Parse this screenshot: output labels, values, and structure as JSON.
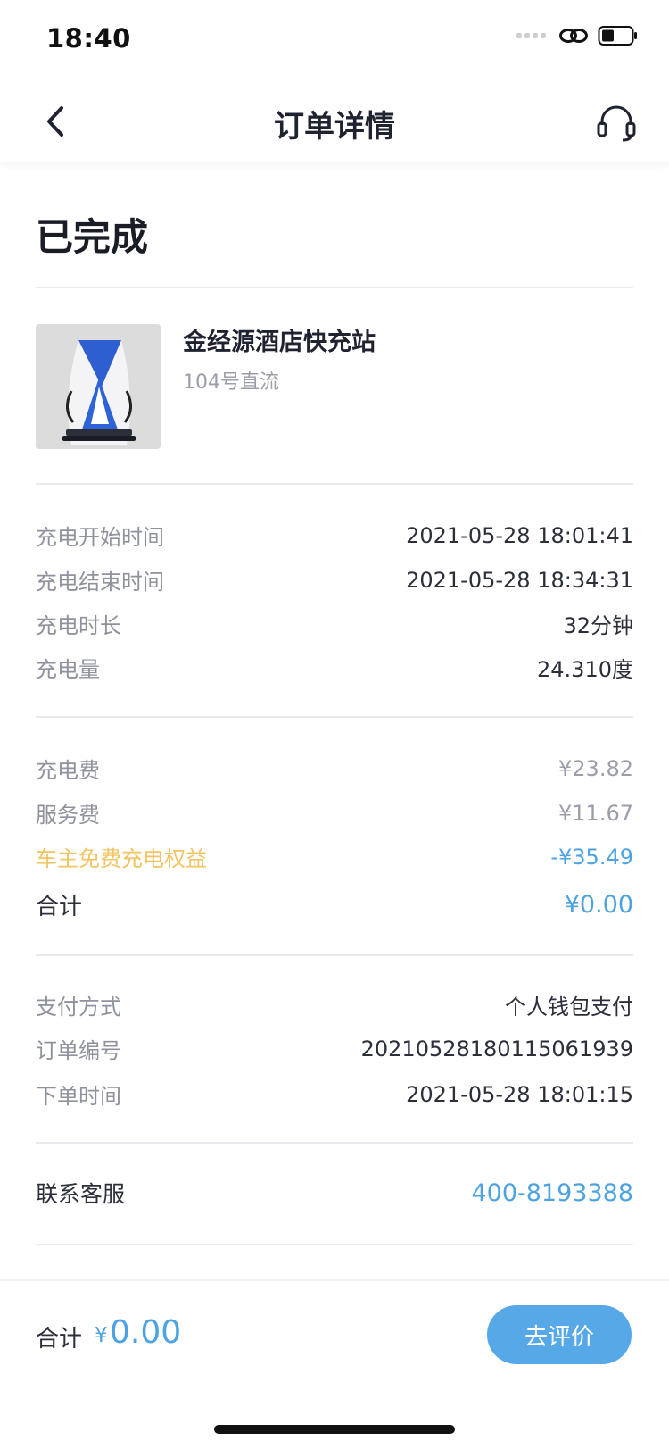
{
  "status_bar": {
    "time": "18:40"
  },
  "nav": {
    "title": "订单详情"
  },
  "order": {
    "status": "已完成"
  },
  "station": {
    "name": "金经源酒店快充站",
    "pile": "104号直流"
  },
  "charging": [
    {
      "label": "充电开始时间",
      "value": "2021-05-28 18:01:41"
    },
    {
      "label": "充电结束时间",
      "value": "2021-05-28 18:34:31"
    },
    {
      "label": "充电时长",
      "value": "32分钟"
    },
    {
      "label": "充电量",
      "value": "24.310度"
    }
  ],
  "fees": {
    "charge_fee_label": "充电费",
    "charge_fee": "¥23.82",
    "service_fee_label": "服务费",
    "service_fee": "¥11.67",
    "benefit_label": "车主免费充电权益",
    "benefit": "-¥35.49",
    "total_label": "合计",
    "total": "¥0.00"
  },
  "payment": [
    {
      "label": "支付方式",
      "value": "个人钱包支付"
    },
    {
      "label": "订单编号",
      "value": "202105281801150619 39"
    },
    {
      "label": "下单时间",
      "value": "2021-05-28 18:01:15"
    }
  ],
  "contact": {
    "label": "联系客服",
    "phone": "400-8193388"
  },
  "footer": {
    "total_label": "合计",
    "currency": "¥",
    "amount": "0.00",
    "review_button": "去评价"
  },
  "icons": {
    "back": "chevron-left-icon",
    "service": "headset-icon",
    "link": "link-icon",
    "battery": "battery-icon"
  },
  "colors": {
    "accent": "#4da3e0",
    "button": "#56a9e6",
    "benefit": "#f2c463"
  }
}
